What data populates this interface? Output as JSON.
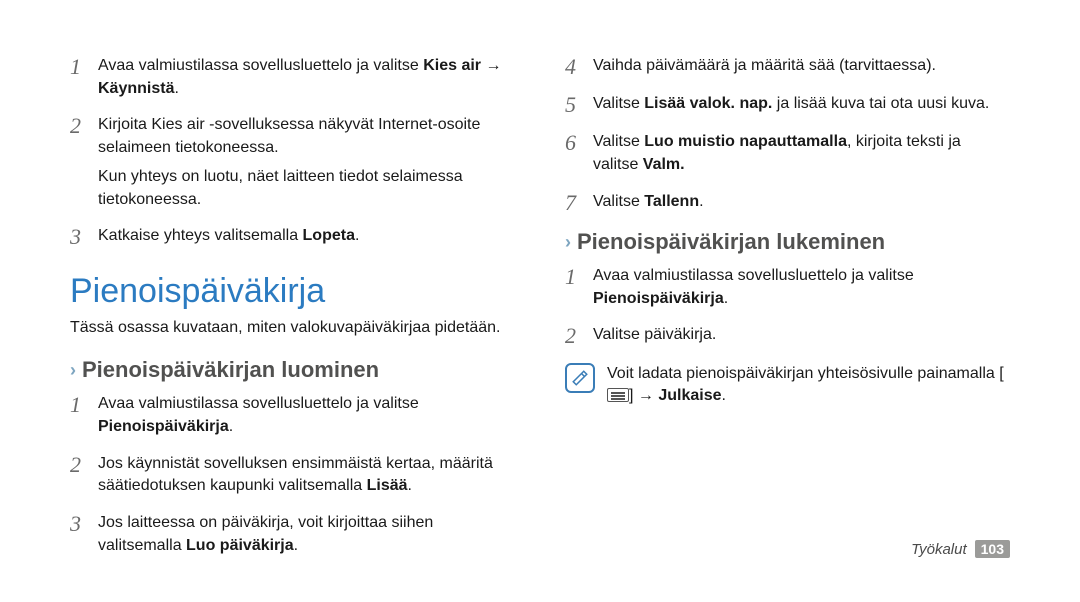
{
  "left": {
    "steps_a": [
      {
        "num": "1",
        "before": "Avaa valmiustilassa sovellusluettelo ja valitse ",
        "bold1": "Kies air",
        "mid": " → ",
        "bold2": "Käynnistä",
        "after": "."
      },
      {
        "num": "2",
        "before": "Kirjoita Kies air -sovelluksessa näkyvät Internet-osoite selaimeen tietokoneessa.",
        "sub": "Kun yhteys on luotu, näet laitteen tiedot selaimessa tietokoneessa."
      },
      {
        "num": "3",
        "before": "Katkaise yhteys valitsemalla ",
        "bold1": "Lopeta",
        "after": "."
      }
    ],
    "section_title": "Pienoispäiväkirja",
    "section_intro": "Tässä osassa kuvataan, miten valokuvapäiväkirjaa pidetään.",
    "subhead": "Pienoispäiväkirjan luominen",
    "steps_b": [
      {
        "num": "1",
        "before": "Avaa valmiustilassa sovellusluettelo ja valitse ",
        "bold1": "Pienoispäiväkirja",
        "after": "."
      },
      {
        "num": "2",
        "before": "Jos käynnistät sovelluksen ensimmäistä kertaa, määritä säätiedotuksen kaupunki valitsemalla ",
        "bold1": "Lisää",
        "after": "."
      },
      {
        "num": "3",
        "before": "Jos laitteessa on päiväkirja, voit kirjoittaa siihen valitsemalla ",
        "bold1": "Luo päiväkirja",
        "after": "."
      }
    ]
  },
  "right": {
    "steps_c": [
      {
        "num": "4",
        "before": "Vaihda päivämäärä ja määritä sää (tarvittaessa)."
      },
      {
        "num": "5",
        "before": "Valitse ",
        "bold1": "Lisää valok. nap.",
        "after": " ja lisää kuva tai ota uusi kuva."
      },
      {
        "num": "6",
        "before": "Valitse ",
        "bold1": "Luo muistio napauttamalla",
        "mid": ", kirjoita teksti ja valitse ",
        "bold2": "Valm.",
        "after": ""
      },
      {
        "num": "7",
        "before": "Valitse ",
        "bold1": "Tallenn",
        "after": "."
      }
    ],
    "subhead2": "Pienoispäiväkirjan lukeminen",
    "steps_d": [
      {
        "num": "1",
        "before": "Avaa valmiustilassa sovellusluettelo ja valitse ",
        "bold1": "Pienoispäiväkirja",
        "after": "."
      },
      {
        "num": "2",
        "before": "Valitse päiväkirja."
      }
    ],
    "note": {
      "before": "Voit ladata pienoispäiväkirjan yhteisösivulle painamalla [",
      "after": "] → ",
      "bold": "Julkaise",
      "tail": "."
    }
  },
  "footer": {
    "section": "Työkalut",
    "page": "103"
  }
}
